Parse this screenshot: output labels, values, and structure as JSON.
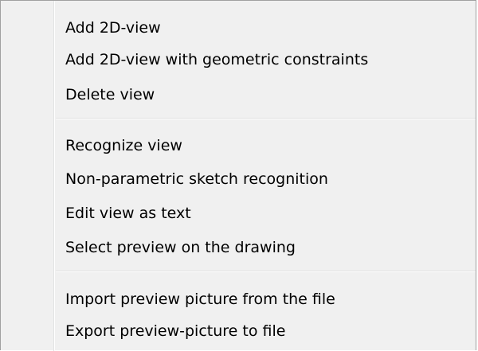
{
  "context_menu": {
    "group1": [
      "Add 2D-view",
      "Add 2D-view with geometric constraints",
      "Delete view"
    ],
    "group2": [
      "Recognize view",
      "Non-parametric sketch recognition",
      "Edit view as text",
      "Select preview on the drawing"
    ],
    "group3": [
      "Import preview picture from the file",
      "Export preview-picture to file"
    ]
  }
}
